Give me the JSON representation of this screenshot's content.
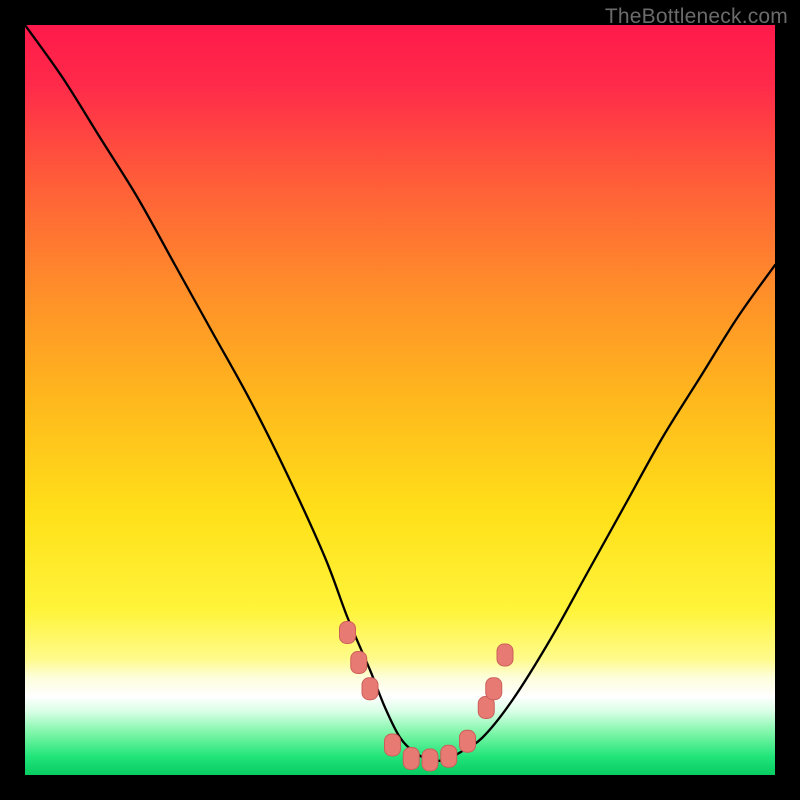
{
  "watermark": "TheBottleneck.com",
  "chart_data": {
    "type": "line",
    "title": "",
    "xlabel": "",
    "ylabel": "",
    "xlim": [
      0,
      100
    ],
    "ylim": [
      0,
      100
    ],
    "grid": false,
    "legend": false,
    "background_gradient_stops": [
      {
        "offset": 0.0,
        "color": "#ff1a4b"
      },
      {
        "offset": 0.08,
        "color": "#ff2a4a"
      },
      {
        "offset": 0.2,
        "color": "#ff5a3a"
      },
      {
        "offset": 0.35,
        "color": "#ff8d2a"
      },
      {
        "offset": 0.5,
        "color": "#ffb81d"
      },
      {
        "offset": 0.65,
        "color": "#ffe019"
      },
      {
        "offset": 0.78,
        "color": "#fff43a"
      },
      {
        "offset": 0.845,
        "color": "#fffb8a"
      },
      {
        "offset": 0.87,
        "color": "#fdfedb"
      },
      {
        "offset": 0.895,
        "color": "#ffffff"
      },
      {
        "offset": 0.915,
        "color": "#d9ffe6"
      },
      {
        "offset": 0.945,
        "color": "#7af5a6"
      },
      {
        "offset": 0.975,
        "color": "#22e57a"
      },
      {
        "offset": 1.0,
        "color": "#07cc62"
      }
    ],
    "series": [
      {
        "name": "bottleneck-curve",
        "color": "#000000",
        "stroke_width": 2.3,
        "x": [
          0,
          5,
          10,
          15,
          20,
          25,
          30,
          35,
          40,
          43,
          46,
          48,
          50,
          52,
          54,
          56,
          58,
          61,
          65,
          70,
          75,
          80,
          85,
          90,
          95,
          100
        ],
        "y": [
          100,
          93,
          85,
          77,
          68,
          59,
          50,
          40,
          29,
          21,
          14,
          9,
          5,
          3,
          2,
          2,
          3,
          5,
          10,
          18,
          27,
          36,
          45,
          53,
          61,
          68
        ]
      }
    ],
    "markers": {
      "name": "inflection-markers",
      "shape": "rounded-rect",
      "fill": "#e77a73",
      "stroke": "#cc5f59",
      "points": [
        {
          "x": 43.0,
          "y": 19.0
        },
        {
          "x": 44.5,
          "y": 15.0
        },
        {
          "x": 46.0,
          "y": 11.5
        },
        {
          "x": 49.0,
          "y": 4.0
        },
        {
          "x": 51.5,
          "y": 2.2
        },
        {
          "x": 54.0,
          "y": 2.0
        },
        {
          "x": 56.5,
          "y": 2.5
        },
        {
          "x": 59.0,
          "y": 4.5
        },
        {
          "x": 61.5,
          "y": 9.0
        },
        {
          "x": 62.5,
          "y": 11.5
        },
        {
          "x": 64.0,
          "y": 16.0
        }
      ]
    }
  }
}
